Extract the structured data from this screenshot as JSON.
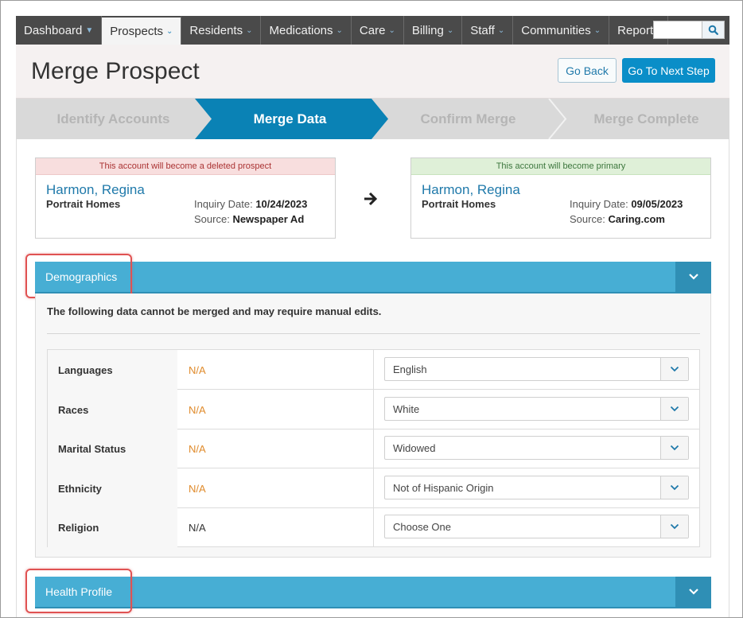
{
  "nav": {
    "items": [
      {
        "label": "Dashboard",
        "dropdown": true
      },
      {
        "label": "Prospects",
        "dropdown": true,
        "active": true
      },
      {
        "label": "Residents",
        "dropdown": true
      },
      {
        "label": "Medications",
        "dropdown": true
      },
      {
        "label": "Care",
        "dropdown": true
      },
      {
        "label": "Billing",
        "dropdown": true
      },
      {
        "label": "Staff",
        "dropdown": true
      },
      {
        "label": "Communities",
        "dropdown": true
      },
      {
        "label": "Reports",
        "dropdown": false
      }
    ],
    "search_icon": "search-icon"
  },
  "header": {
    "title": "Merge Prospect",
    "go_back": "Go Back",
    "go_next": "Go To Next Step"
  },
  "steps": [
    {
      "label": "Identify Accounts",
      "state": "done"
    },
    {
      "label": "Merge Data",
      "state": "active"
    },
    {
      "label": "Confirm Merge",
      "state": "pending"
    },
    {
      "label": "Merge Complete",
      "state": "pending"
    }
  ],
  "accounts": {
    "deleted": {
      "banner": "This account will become a deleted prospect",
      "name": "Harmon, Regina",
      "community": "Portrait Homes",
      "inquiry_label": "Inquiry Date:",
      "inquiry_date": "10/24/2023",
      "source_label": "Source:",
      "source": "Newspaper Ad"
    },
    "primary": {
      "banner": "This account will become primary",
      "name": "Harmon, Regina",
      "community": "Portrait Homes",
      "inquiry_label": "Inquiry Date:",
      "inquiry_date": "09/05/2023",
      "source_label": "Source:",
      "source": "Caring.com"
    },
    "arrow_icon": "arrow-right-icon"
  },
  "demographics": {
    "title": "Demographics",
    "note": "The following data cannot be merged and may require manual edits.",
    "rows": [
      {
        "label": "Languages",
        "deleted_value": "N/A",
        "selected": "English"
      },
      {
        "label": "Races",
        "deleted_value": "N/A",
        "selected": "White"
      },
      {
        "label": "Marital Status",
        "deleted_value": "N/A",
        "selected": "Widowed"
      },
      {
        "label": "Ethnicity",
        "deleted_value": "N/A",
        "selected": "Not of Hispanic Origin"
      },
      {
        "label": "Religion",
        "deleted_value": "N/A",
        "selected": "Choose One"
      }
    ]
  },
  "health_profile": {
    "title": "Health Profile"
  },
  "colors": {
    "nav_bg": "#4a4a4a",
    "primary_button": "#0a8ec8",
    "section_bar": "#47aed4",
    "step_active": "#0a82b5",
    "highlight": "#e05252",
    "na_orange": "#e08b2c"
  }
}
